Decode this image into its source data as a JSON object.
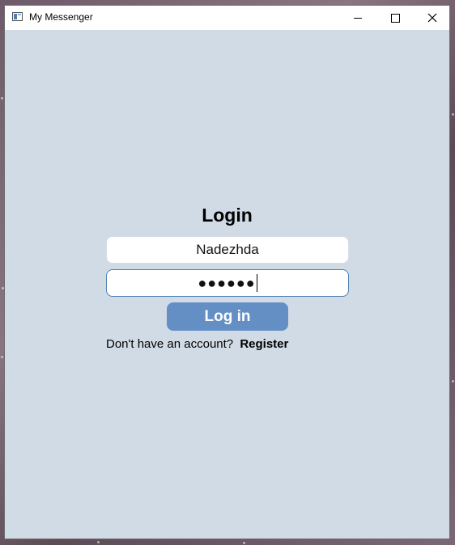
{
  "window": {
    "title": "My Messenger",
    "minimize_glyph": "minimize-icon",
    "maximize_glyph": "maximize-icon",
    "close_glyph": "✕"
  },
  "login": {
    "heading": "Login",
    "username_value": "Nadezhda",
    "password_mask": "●●●●●●",
    "login_button_label": "Log in",
    "no_account_text": "Don't have an account?",
    "register_link_label": "Register"
  },
  "colors": {
    "window_background": "#d0dbe6",
    "button_background": "#648fc4",
    "focused_border": "#4e7fb4"
  }
}
